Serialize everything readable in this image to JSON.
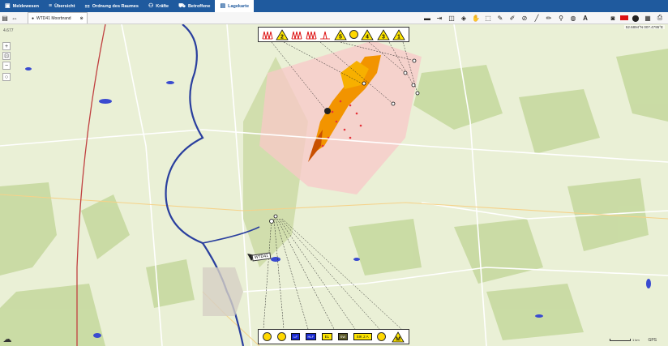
{
  "nav": {
    "tabs": [
      {
        "label": "Meldewesen",
        "icon": "inbox-icon"
      },
      {
        "label": "Übersicht",
        "icon": "list-icon"
      },
      {
        "label": "Ordnung des Raumes",
        "icon": "hierarchy-icon"
      },
      {
        "label": "Kräfte",
        "icon": "people-icon"
      },
      {
        "label": "Betroffene",
        "icon": "car-icon"
      },
      {
        "label": "Lagekarte",
        "icon": "map-icon"
      }
    ],
    "active_index": 5
  },
  "toolbar": {
    "map_name": "WTD41 Moorbrand"
  },
  "map": {
    "scale_text": "4.677",
    "coords_text": "52.6894°N 007.4795°E",
    "unit_label": "WTD41",
    "gps_label": "GPS",
    "scale_bar_text": "1 km"
  },
  "top_symbols": [
    {
      "type": "fire",
      "label": ""
    },
    {
      "type": "triangle",
      "label": "2"
    },
    {
      "type": "fire",
      "label": ""
    },
    {
      "type": "fire",
      "label": ""
    },
    {
      "type": "fire-single",
      "label": ""
    },
    {
      "type": "triangle",
      "label": "5"
    },
    {
      "type": "circle",
      "label": ""
    },
    {
      "type": "triangle",
      "label": "4"
    },
    {
      "type": "triangle",
      "label": "3"
    },
    {
      "type": "triangle",
      "label": "1"
    }
  ],
  "bottom_symbols": [
    {
      "type": "circle",
      "label": ""
    },
    {
      "type": "circle",
      "label": ""
    },
    {
      "type": "blue",
      "label": "LF"
    },
    {
      "type": "blue",
      "label": "HLF"
    },
    {
      "type": "yellow",
      "label": "EL"
    },
    {
      "type": "olive",
      "label": "SW"
    },
    {
      "type": "yellow",
      "label": "SIK 2 A"
    },
    {
      "type": "circle",
      "label": ""
    },
    {
      "type": "triangle",
      "label": "M"
    }
  ],
  "colors": {
    "nav": "#1f5a9e",
    "fire_orange": "#f29400",
    "fire_dark": "#c85000",
    "burn_area": "#f8c8c8",
    "river": "#2a3f9e",
    "forest": "#c6d89f",
    "field": "#f0f4dc",
    "symbol_yellow": "#ffe600"
  }
}
